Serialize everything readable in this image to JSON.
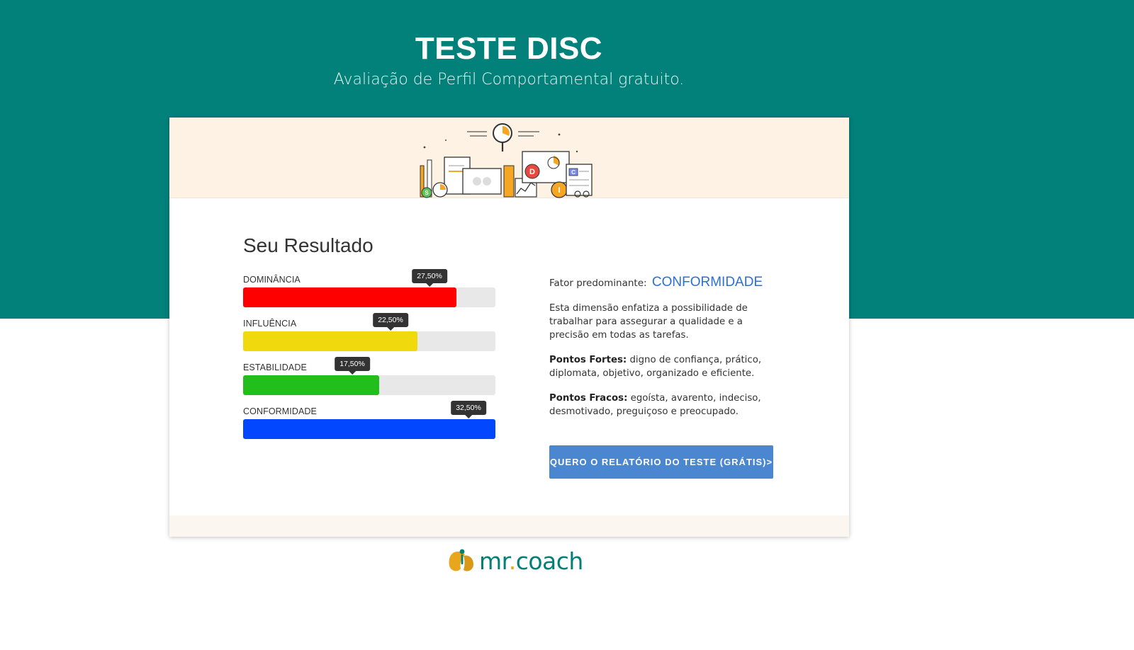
{
  "header": {
    "title": "TESTE DISC",
    "subtitle": "Avaliação de Perfil Comportamental gratuito."
  },
  "result": {
    "title": "Seu Resultado",
    "bars": [
      {
        "label": "DOMINÂNCIA",
        "percent_text": "27,50%",
        "value": 27.5,
        "color": "#ff0000"
      },
      {
        "label": "INFLUÊNCIA",
        "percent_text": "22,50%",
        "value": 22.5,
        "color": "#f0d90c"
      },
      {
        "label": "ESTABILIDADE",
        "percent_text": "17,50%",
        "value": 17.5,
        "color": "#22bf1c"
      },
      {
        "label": "CONFORMIDADE",
        "percent_text": "32,50%",
        "value": 32.5,
        "color": "#0247fd"
      }
    ]
  },
  "profile": {
    "factor_prefix": "Fator predominante:",
    "factor_value": "CONFORMIDADE",
    "description": "Esta dimensão enfatiza a possibilidade de trabalhar para assegurar a qualidade e a precisão em todas as tarefas.",
    "strengths_label": "Pontos Fortes:",
    "strengths_text": "digno de confiança, prático, diplomata, objetivo, organizado e eficiente.",
    "weaknesses_label": "Pontos Fracos:",
    "weaknesses_text": "egoísta, avarento, indeciso, desmotivado, preguiçoso e preocupado.",
    "cta_label": "QUERO O RELATÓRIO DO TESTE (GRÁTIS)>"
  },
  "banner": {
    "letters": [
      "D",
      "I",
      "S",
      "C"
    ]
  },
  "footer": {
    "logo_text_a": "mr",
    "logo_dot": ".",
    "logo_text_b": "coach"
  },
  "colors": {
    "accent": "#02807a",
    "button": "#4a87d0",
    "factor": "#2a6fdb"
  }
}
